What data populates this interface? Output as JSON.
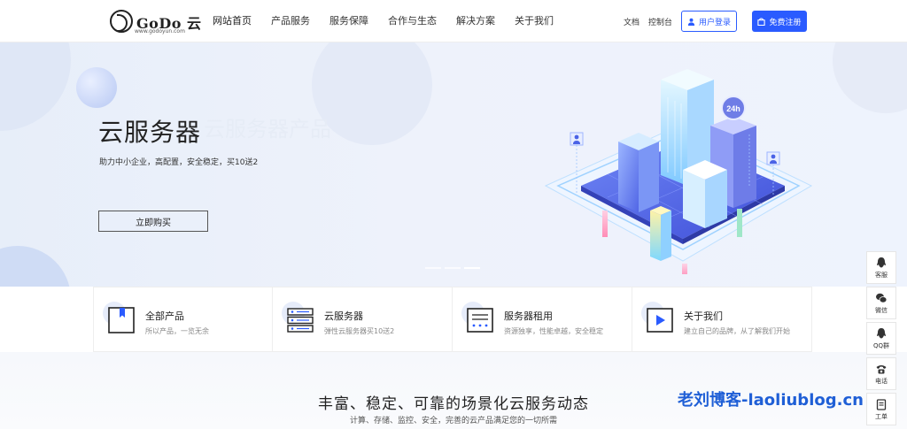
{
  "header": {
    "logo_text": "GoDo 云",
    "logo_url": "www.godoyun.com",
    "nav": [
      "网站首页",
      "产品服务",
      "服务保障",
      "合作与生态",
      "解决方案",
      "关于我们"
    ],
    "links": [
      "文档",
      "控制台"
    ],
    "login_label": "用户登录",
    "register_label": "免费注册"
  },
  "banner": {
    "title": "云服务器",
    "watermark": "云服务器产品",
    "subtitle": "助力中小企业，高配置，安全稳定，买10送2",
    "button_label": "立即购买",
    "badge": "24h",
    "slides": 3,
    "active_slide": 3
  },
  "cards": [
    {
      "title": "全部产品",
      "desc": "所以产品，一览无余",
      "icon": "bookmark-icon"
    },
    {
      "title": "云服务器",
      "desc": "弹性云服务器买10送2",
      "icon": "server-icon"
    },
    {
      "title": "服务器租用",
      "desc": "资源独享，性能卓越，安全稳定",
      "icon": "list-window-icon"
    },
    {
      "title": "关于我们",
      "desc": "建立自己的品牌，从了解我们开始",
      "icon": "play-icon"
    }
  ],
  "section": {
    "title": "丰富、稳定、可靠的场景化云服务动态",
    "subtitle": "计算、存储、监控、安全，完善的云产品满足您的一切所需"
  },
  "watermark": "老刘博客-laoliublog.cn",
  "float_bar": [
    {
      "label": "客服",
      "icon": "qq-icon"
    },
    {
      "label": "微信",
      "icon": "wechat-icon"
    },
    {
      "label": "QQ群",
      "icon": "qq-group-icon"
    },
    {
      "label": "电话",
      "icon": "phone-icon"
    },
    {
      "label": "工单",
      "icon": "ticket-icon"
    }
  ],
  "colors": {
    "brand": "#2a5bff",
    "watermark": "#1f5fd6"
  }
}
